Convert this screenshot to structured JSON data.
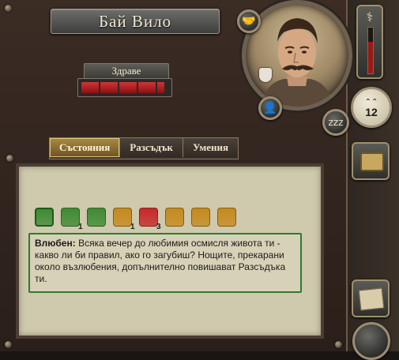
{
  "character": {
    "name": "Бай Вило",
    "level": "12"
  },
  "health": {
    "label": "Здраве",
    "fraction": 0.95
  },
  "tabs": [
    {
      "label": "Състояния",
      "active": true
    },
    {
      "label": "Разсъдък",
      "active": false
    },
    {
      "label": "Умения",
      "active": false
    }
  ],
  "statuses": [
    {
      "icon": "heart-icon",
      "color": "#3f8a33",
      "count": "",
      "selected": true
    },
    {
      "icon": "mask-icon",
      "color": "#3f8a33",
      "count": "1",
      "selected": false
    },
    {
      "icon": "fist-icon",
      "color": "#3f8a33",
      "count": "",
      "selected": false
    },
    {
      "icon": "drink-icon",
      "color": "#c48a1d",
      "count": "1",
      "selected": false
    },
    {
      "icon": "wound-icon",
      "color": "#c62828",
      "count": "3",
      "selected": false
    },
    {
      "icon": "fist-icon",
      "color": "#c48a1d",
      "count": "",
      "selected": false
    },
    {
      "icon": "fist-icon",
      "color": "#c48a1d",
      "count": "",
      "selected": false
    },
    {
      "icon": "flame-icon",
      "color": "#c48a1d",
      "count": "",
      "selected": false
    }
  ],
  "tooltip": {
    "title": "Влюбен:",
    "body": "Всяка вечер до любимия осмисля живота ти - какво ли би правил, ако го загубиш? Нощите, прекарани около възлюбения, допълнително повишават Разсъдъка ти."
  },
  "colors": {
    "accent": "#d9b35f",
    "health": "#c62828",
    "tooltip_border": "#2e7a2e"
  },
  "hud_icons": [
    "handshake-icon",
    "caduceus-icon",
    "theater-mask-icon",
    "person-icon",
    "sleep-zzz-icon",
    "chest-icon",
    "map-icon",
    "compass-icon"
  ]
}
